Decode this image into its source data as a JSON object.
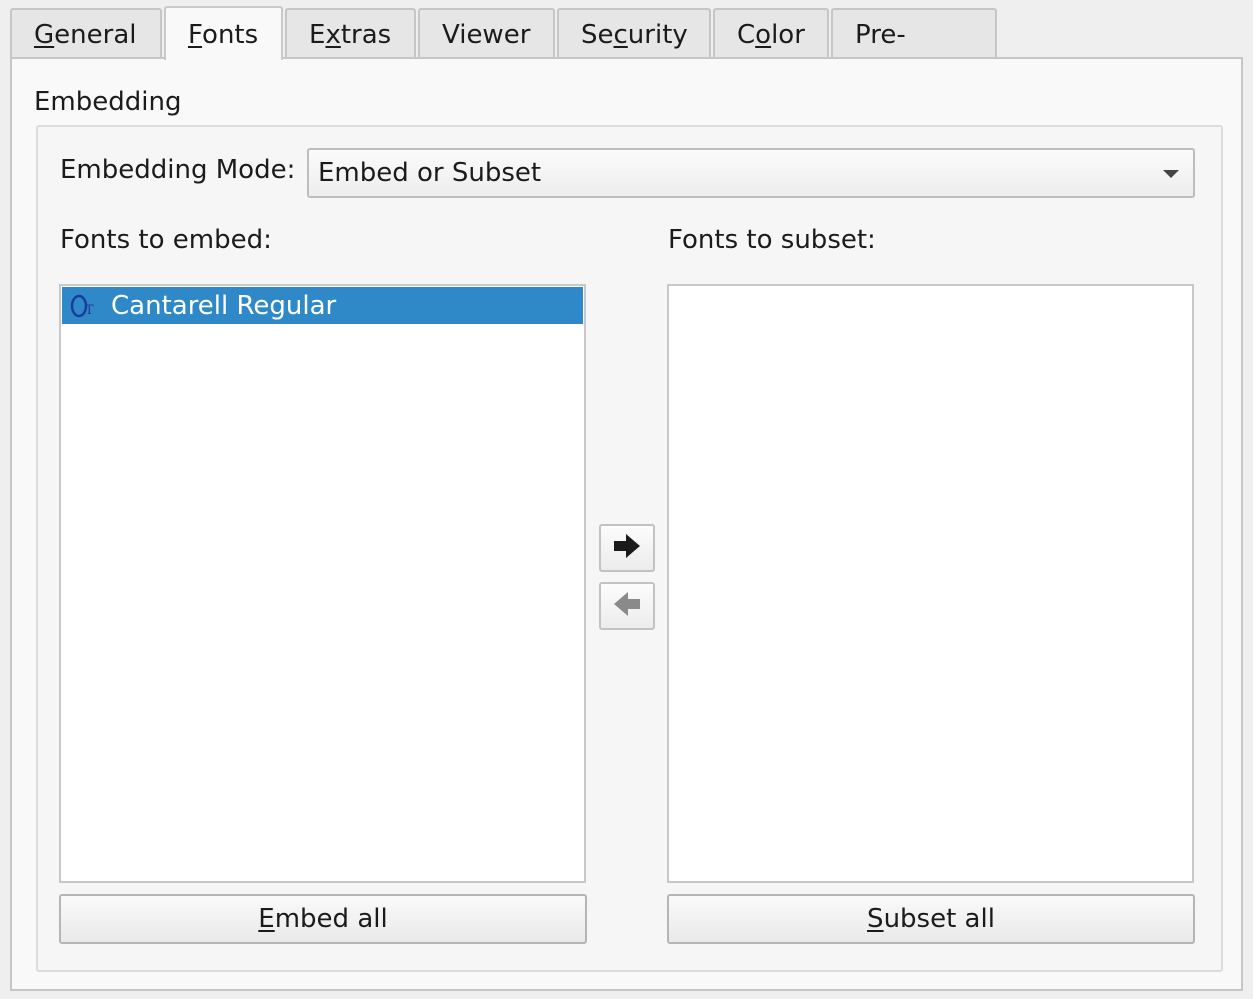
{
  "tabs": [
    {
      "label_pre": "",
      "label_ul": "G",
      "label_post": "eneral"
    },
    {
      "label_pre": "",
      "label_ul": "F",
      "label_post": "onts"
    },
    {
      "label_pre": "E",
      "label_ul": "x",
      "label_post": "tras"
    },
    {
      "label_pre": "Viewer",
      "label_ul": "",
      "label_post": ""
    },
    {
      "label_pre": "Se",
      "label_ul": "c",
      "label_post": "urity"
    },
    {
      "label_pre": "C",
      "label_ul": "o",
      "label_post": "lor"
    },
    {
      "label_pre": "Pre-Press",
      "label_ul": "",
      "label_post": ""
    }
  ],
  "active_tab": "Fonts",
  "section": {
    "title": "Embedding"
  },
  "mode": {
    "label": "Embedding Mode:",
    "value": "Embed or Subset"
  },
  "embed_list": {
    "label": "Fonts to embed:",
    "items": [
      "Cantarell Regular"
    ]
  },
  "subset_list": {
    "label": "Fonts to subset:",
    "items": []
  },
  "buttons": {
    "embed_all": {
      "ul": "E",
      "rest": "mbed all"
    },
    "subset_all": {
      "ul": "S",
      "rest": "ubset all"
    }
  },
  "icons": {
    "move_right": "arrow-right-icon",
    "move_left": "arrow-left-icon",
    "font_type": "opentype-font-icon"
  },
  "colors": {
    "selection": "#2f89c9",
    "font_icon": "#1a3c9c"
  }
}
